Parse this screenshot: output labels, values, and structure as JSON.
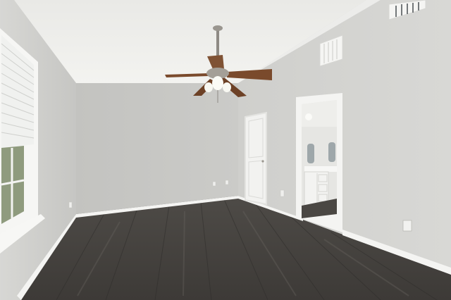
{
  "scene": {
    "kind": "photo",
    "room": "empty-bedroom",
    "features": [
      "ceiling-fan",
      "window-with-blinds",
      "closet-door",
      "bathroom-doorway",
      "dark-wood-floor",
      "hvac-vents",
      "outlets"
    ]
  },
  "colors": {
    "ceiling": "#f2f2ef",
    "wall_light": "#d6d6d3",
    "wall_mid": "#c9c9c6",
    "wall_shadow": "#b8b8b5",
    "trim": "#f4f4f2",
    "floor_dark": "#3a3836",
    "floor_mid": "#54514d",
    "fan_wood": "#7a4a2c",
    "fan_metal": "#8e8a84"
  }
}
